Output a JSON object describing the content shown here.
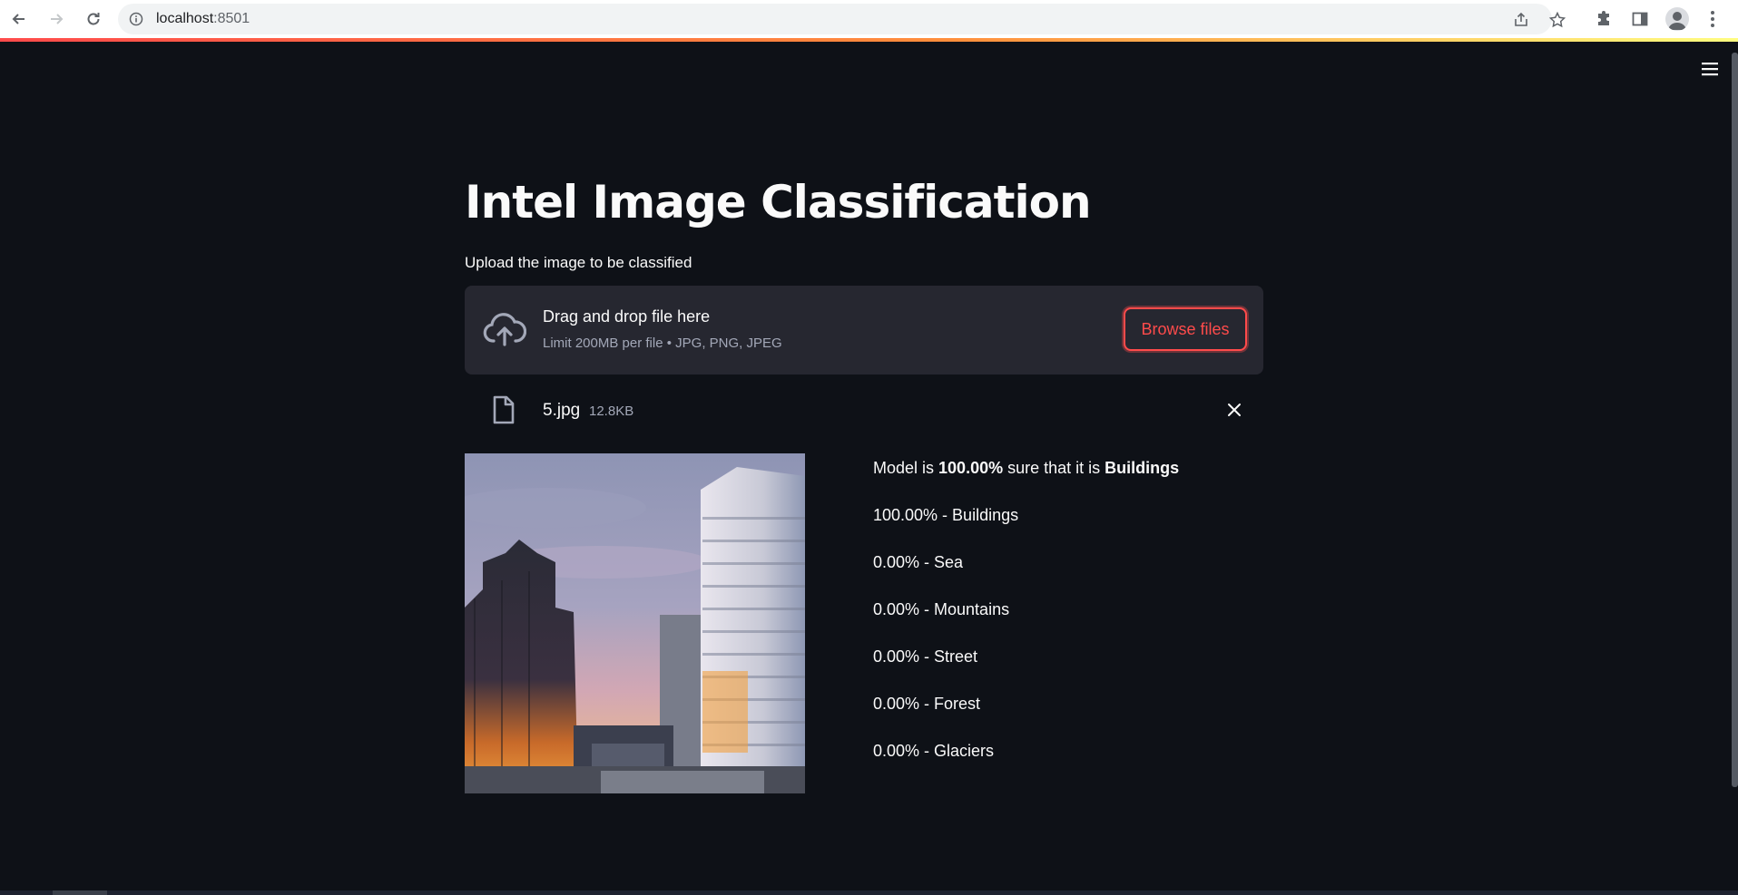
{
  "browser": {
    "url_host": "localhost",
    "url_port": ":8501",
    "icons": [
      "back-icon",
      "forward-icon",
      "reload-icon",
      "site-info-icon",
      "share-icon",
      "star-icon",
      "extensions-icon",
      "side-panel-icon",
      "profile-icon",
      "menu-kebab-icon"
    ]
  },
  "app": {
    "title": "Intel Image Classification",
    "uploader_label": "Upload the image to be classified",
    "dropzone": {
      "title": "Drag and drop file here",
      "subtitle": "Limit 200MB per file • JPG, PNG, JPEG",
      "browse_label": "Browse files"
    },
    "uploaded_file": {
      "name": "5.jpg",
      "size": "12.8KB"
    },
    "result": {
      "prefix": "Model is ",
      "confidence": "100.00%",
      "middle": " sure that it is ",
      "label": "Buildings"
    },
    "probabilities": [
      "100.00% - Buildings",
      "0.00% - Sea",
      "0.00% - Mountains",
      "0.00% - Street",
      "0.00% - Forest",
      "0.00% - Glaciers"
    ]
  },
  "colors": {
    "background": "#0e1117",
    "surface": "#262730",
    "accent": "#ff4b4b",
    "muted_text": "#a3a8b8"
  }
}
